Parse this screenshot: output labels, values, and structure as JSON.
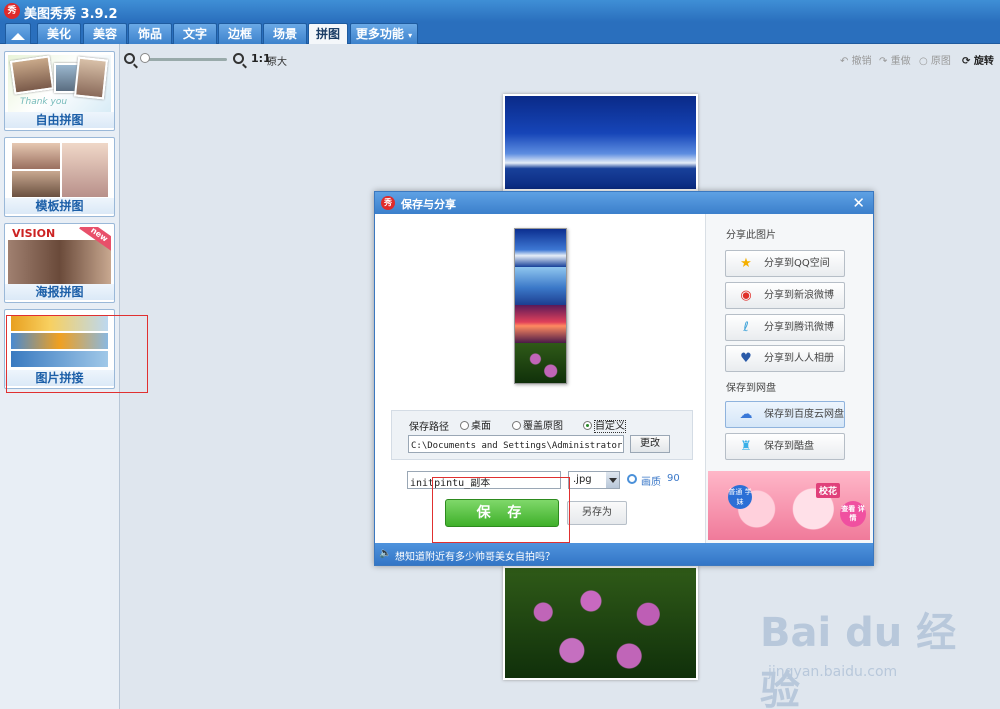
{
  "app": {
    "title": "美图秀秀 3.9.2",
    "logo": "秀"
  },
  "tabs": [
    {
      "label": "美化"
    },
    {
      "label": "美容"
    },
    {
      "label": "饰品"
    },
    {
      "label": "文字"
    },
    {
      "label": "边框"
    },
    {
      "label": "场景"
    },
    {
      "label": "拼图"
    },
    {
      "label": "更多功能"
    }
  ],
  "active_tab": "拼图",
  "left_panel": {
    "items": [
      {
        "label": "自由拼图",
        "thumb_text": "Thank you"
      },
      {
        "label": "模板拼图",
        "thumb_text": ""
      },
      {
        "label": "海报拼图",
        "thumb_text": "VISION",
        "badge": "new"
      },
      {
        "label": "图片拼接",
        "thumb_text": ""
      }
    ]
  },
  "toolbar": {
    "zoom_ratio": "1:1",
    "original_size": "原大",
    "undo": "撤销",
    "redo": "重做",
    "restore": "原图",
    "rotate": "旋转"
  },
  "dialog": {
    "title": "保存与分享",
    "logo": "秀",
    "path_label": "保存路径",
    "path_options": [
      "桌面",
      "覆盖原图",
      "自定义"
    ],
    "selected_path_option": "自定义",
    "path_value": "C:\\Documents and Settings\\Administrator\\桌",
    "change_button": "更改",
    "filename_value": "initpintu_副本",
    "format_value": ".jpg",
    "quality_label": "画质",
    "quality_value": "90",
    "save_button": "保 存",
    "save_as_button": "另存为",
    "share_section": "分享此图片",
    "share_buttons": [
      "分享到QQ空间",
      "分享到新浪微博",
      "分享到腾讯微博",
      "分享到人人相册"
    ],
    "cloud_section": "保存到网盘",
    "cloud_buttons": [
      "保存到百度云网盘",
      "保存到酷盘"
    ],
    "ad": {
      "badge": "普通 学妹",
      "tag": "校花",
      "see": "查看 详情"
    },
    "footer_text": "想知道附近有多少帅哥美女自拍吗？"
  },
  "watermark": {
    "brand": "Bai du 经验",
    "url": "jingyan.baidu.com"
  }
}
